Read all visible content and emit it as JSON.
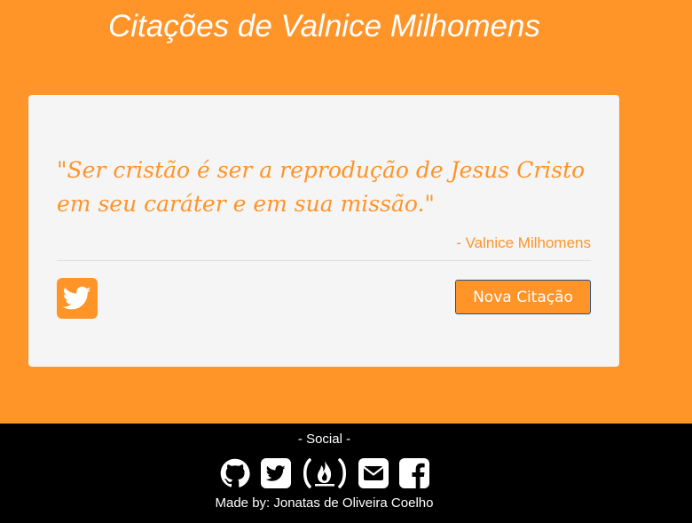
{
  "header": {
    "title": "Citações de Valnice Milhomens"
  },
  "quote": {
    "text": "\"Ser cristão é ser a reprodução de Jesus Cristo em seu caráter e em sua missão.\"",
    "author": "- Valnice Milhomens"
  },
  "actions": {
    "tweet_icon": "twitter-icon",
    "new_quote_label": "Nova Citação"
  },
  "footer": {
    "social_label": "- Social -",
    "icons": [
      "github-icon",
      "twitter-icon",
      "freecodecamp-icon",
      "envelope-icon",
      "facebook-icon"
    ],
    "made_by": "Made by: Jonatas de Oliveira Coelho"
  },
  "colors": {
    "background": "#ff9429",
    "card": "#f5f5f5",
    "footer": "#000000",
    "accent": "#ff9429"
  }
}
